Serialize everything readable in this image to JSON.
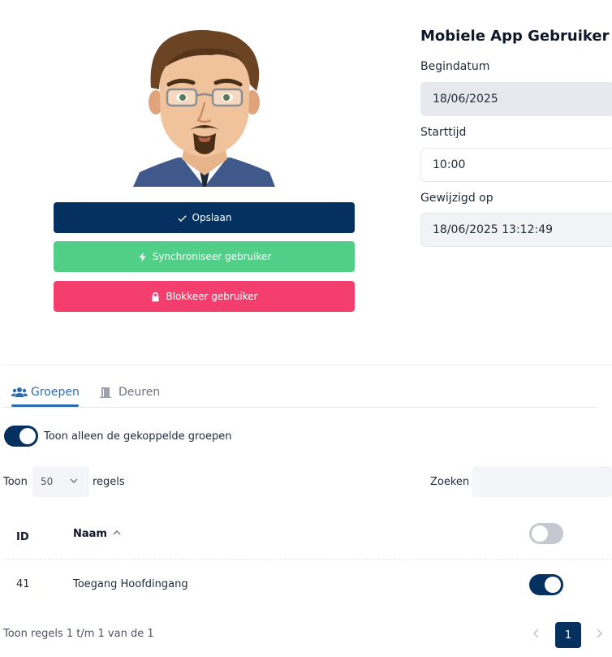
{
  "profile": {
    "avatar_icon": "cartoon-man-avatar"
  },
  "actions": {
    "save_label": "Opslaan",
    "sync_label": "Synchroniseer gebruiker",
    "block_label": "Blokkeer gebruiker"
  },
  "form": {
    "title": "Mobiele App Gebruiker",
    "start_date_label": "Begindatum",
    "start_date_value": "18/06/2025",
    "start_time_label": "Starttijd",
    "start_time_value": "10:00",
    "modified_label": "Gewijzigd op",
    "modified_value": "18/06/2025 13:12:49"
  },
  "tabs": [
    {
      "label": "Groepen",
      "icon": "users-icon",
      "active": true
    },
    {
      "label": "Deuren",
      "icon": "door-icon",
      "active": false
    }
  ],
  "filter": {
    "linked_only_label": "Toon alleen de gekoppelde groepen",
    "linked_only_on": true
  },
  "table_controls": {
    "show_label": "Toon",
    "page_length": "50",
    "rows_label": "regels",
    "search_label": "Zoeken",
    "search_value": ""
  },
  "table": {
    "columns": [
      "ID",
      "Naam"
    ],
    "header_toggle_on": false,
    "rows": [
      {
        "id": "41",
        "name": "Toegang Hoofdingang",
        "linked": true
      }
    ]
  },
  "pagination": {
    "info": "Toon regels 1 t/m 1 van de 1",
    "current_page": "1"
  },
  "colors": {
    "primary": "#04315f",
    "success": "#51cf88",
    "danger": "#f43f6e",
    "tab_active": "#2b6cb0"
  }
}
